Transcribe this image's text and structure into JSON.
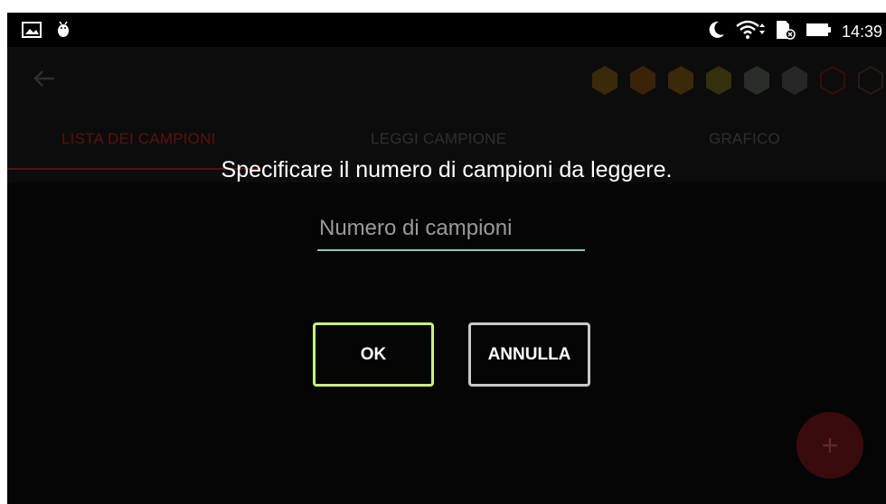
{
  "status_bar": {
    "time": "14:39",
    "left_icons": [
      "image-icon",
      "android-debug-icon"
    ],
    "right_icons": [
      "moon-icon",
      "wifi-icon",
      "sim-card-icon",
      "battery-icon"
    ]
  },
  "app_bar": {
    "back_icon": "back-arrow-icon",
    "hex_icons": [
      "hex-filled",
      "hex-filled",
      "hex-filled",
      "hex-filled",
      "hex-filled",
      "hex-filled",
      "hex-outline-red",
      "hex-outline-red"
    ]
  },
  "tabs": [
    {
      "label": "LISTA DEI CAMPIONI",
      "selected": true
    },
    {
      "label": "LEGGI CAMPIONE",
      "selected": false
    },
    {
      "label": "GRAFICO",
      "selected": false
    }
  ],
  "dialog": {
    "title": "Specificare il numero di campioni da leggere.",
    "input_placeholder": "Numero di campioni",
    "input_value": "",
    "ok_label": "OK",
    "cancel_label": "ANNULLA"
  },
  "fab": {
    "label": "+"
  },
  "colors": {
    "background": "#000000",
    "accent_red": "#b0191a",
    "ok_border": "#c5f27a",
    "input_underline": "#7dcfb6"
  }
}
